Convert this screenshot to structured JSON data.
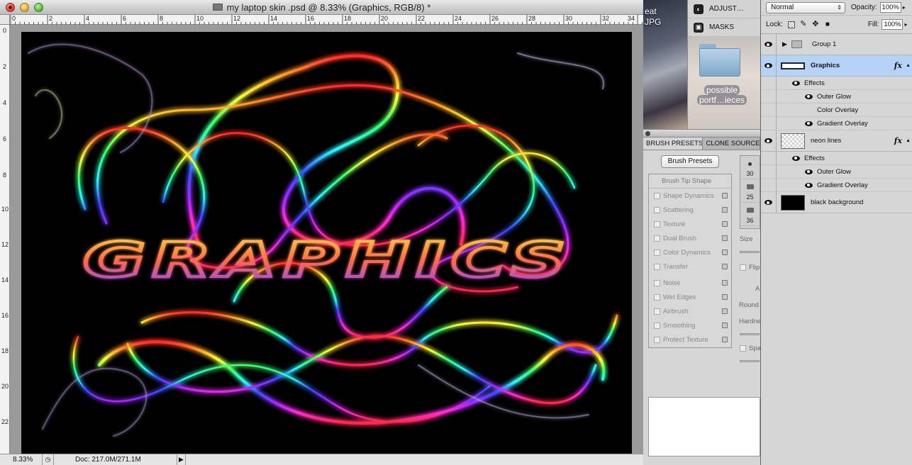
{
  "window": {
    "title": "my laptop skin .psd @ 8.33% (Graphics, RGB/8) *"
  },
  "rulers": {
    "top": [
      "0",
      "2",
      "4",
      "6",
      "8",
      "10",
      "12",
      "14",
      "16",
      "18",
      "20",
      "22",
      "24",
      "26",
      "28",
      "30",
      "32",
      "34"
    ],
    "left": [
      "0",
      "2",
      "4",
      "6",
      "8",
      "10",
      "12",
      "14",
      "16",
      "18",
      "20",
      "22"
    ]
  },
  "canvas": {
    "text": "GRAPHICS"
  },
  "status": {
    "zoom": "8.33%",
    "doc": "Doc: 217.0M/271.1M"
  },
  "desktop": {
    "text_1": "eat",
    "text_2": "JPG",
    "folder_label_1": "possible",
    "folder_label_2": "portf…ieces"
  },
  "adjust_panel": {
    "item_1": "ADJUST…",
    "item_2": "MASKS"
  },
  "brush_panel": {
    "tab_1": "BRUSH PRESETS",
    "tab_2": "CLONE SOURCE",
    "presets_button": "Brush Presets",
    "header": "Brush Tip Shape",
    "items_group_1": [
      "Shape Dynamics",
      "Scattering",
      "Texture",
      "Dual Brush",
      "Color Dynamics",
      "Transfer"
    ],
    "items_group_2": [
      "Noise",
      "Wet Edges",
      "Airbrush",
      "Smoothing",
      "Protect Texture"
    ],
    "tip_sizes": [
      "30",
      "25",
      "36"
    ],
    "side_labels": {
      "size": "Size",
      "flip": "Flip",
      "angle": "A",
      "roundness": "Round",
      "hardness": "Hardne",
      "spacing": "Spa"
    }
  },
  "layers_panel": {
    "blend_mode": "Normal",
    "opacity_label": "Opacity:",
    "opacity_value": "100%",
    "lock_label": "Lock:",
    "fill_label": "Fill:",
    "fill_value": "100%",
    "fx_symbol": "fx",
    "layers": [
      {
        "name": "Group 1"
      },
      {
        "name": "Graphics"
      },
      {
        "name": "neon lines"
      },
      {
        "name": "black background"
      }
    ],
    "graphics_effects": {
      "label": "Effects",
      "items": [
        "Outer Glow",
        "Color Overlay",
        "Gradient Overlay"
      ]
    },
    "neon_effects": {
      "label": "Effects",
      "items": [
        "Outer Glow",
        "Gradient Overlay"
      ]
    }
  }
}
